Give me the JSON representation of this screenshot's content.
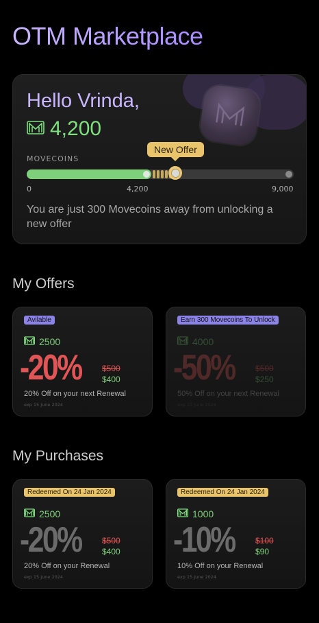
{
  "app_title": "OTM Marketplace",
  "hero": {
    "greeting": "Hello Vrinda,",
    "coins": "4,200",
    "label": "MOVECOINS",
    "new_offer": "New Offer",
    "ticks": [
      "0",
      "4,200",
      "9,000"
    ],
    "progress_fraction": 0.4667,
    "offer_marker_fraction": 0.5556,
    "message": "You are just 300 Movecoins away from unlocking a new offer"
  },
  "offers": {
    "title": "My Offers",
    "cards": [
      {
        "badge": "Avilable",
        "coins": "2500",
        "discount": "-20%",
        "old_price": "$500",
        "new_price": "$400",
        "desc": "20% Off on your next Renewal",
        "expiry": "exp 15 June 2024"
      },
      {
        "badge": "Earn 300 Movecoins To Unlock",
        "coins": "4000",
        "discount": "-50%",
        "old_price": "$500",
        "new_price": "$250",
        "desc": "50% Off on your next Renewal",
        "expiry": "exp 15 June 2024"
      }
    ]
  },
  "purchases": {
    "title": "My Purchases",
    "cards": [
      {
        "badge": "Redeemed On 24 Jan 2024",
        "coins": "2500",
        "discount": "-20%",
        "old_price": "$500",
        "new_price": "$400",
        "desc": "20% Off on your Renewal",
        "expiry": "exp 15 June 2024"
      },
      {
        "badge": "Redeemed On 24 Jan 2024",
        "coins": "1000",
        "discount": "-10%",
        "old_price": "$100",
        "new_price": "$90",
        "desc": "10% Off on your Renewal",
        "expiry": "exp 15 June 2024"
      }
    ]
  },
  "colors": {
    "accent_purple": "#a78bff",
    "green": "#7ed07a",
    "yellow": "#e9c46a",
    "red_discount": "#e05555",
    "grey_discount": "#6b6b6b"
  },
  "icons": {
    "coin": "movecoin-icon"
  }
}
